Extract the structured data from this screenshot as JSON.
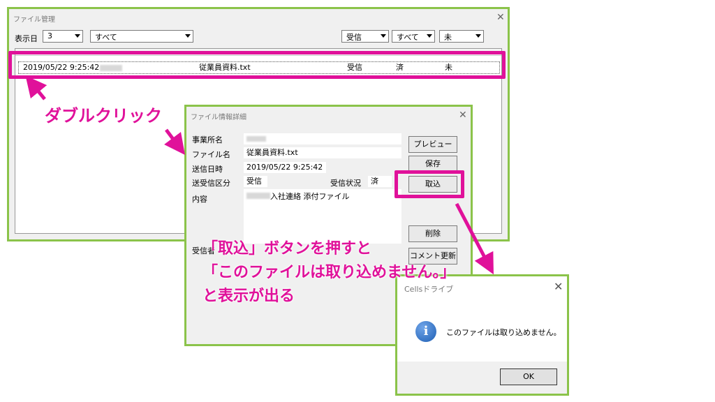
{
  "file_manager": {
    "title": "ファイル管理",
    "days_label": "表示日",
    "days_value": "3",
    "filter_all": "すべて",
    "dir_filter": "受信",
    "status_filter": "すべて",
    "import_filter": "未",
    "row": {
      "datetime": "2019/05/22 9:25:42",
      "filename": "従業員資料.txt",
      "direction": "受信",
      "status": "済",
      "imported": "未"
    }
  },
  "detail": {
    "title": "ファイル情報詳細",
    "office_label": "事業所名",
    "filename_label": "ファイル名",
    "filename_value": "従業員資料.txt",
    "sent_label": "送信日時",
    "sent_value": "2019/05/22 9:25:42",
    "type_label": "送受信区分",
    "type_value": "受信",
    "recv_status_label": "受信状況",
    "recv_status_value": "済",
    "content_label": "内容",
    "content_value": "入社連絡 添付ファイル",
    "receiver_label": "受信者",
    "buttons": {
      "preview": "プレビュー",
      "save": "保存",
      "import": "取込",
      "delete": "削除",
      "comment": "コメント更新"
    }
  },
  "msgbox": {
    "title": "Cellsドライブ",
    "message": "このファイルは取り込めません。",
    "ok": "OK"
  },
  "annotations": {
    "double_click": "ダブルクリック",
    "line1": "「取込」ボタンを押すと",
    "line2": "「このファイルは取り込めません。」",
    "line3": "と表示が出る"
  },
  "colors": {
    "frame": "#8bc34a",
    "highlight": "#e0119a",
    "info": "#1e5fb4"
  }
}
